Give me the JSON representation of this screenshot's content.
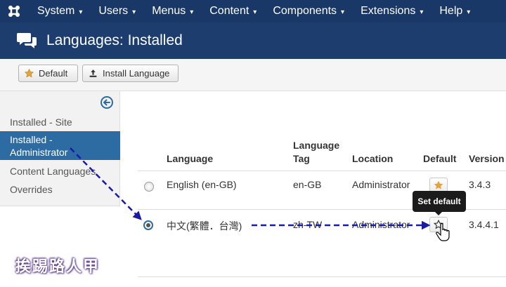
{
  "nav": {
    "items": [
      {
        "label": "System",
        "caret": "▾"
      },
      {
        "label": "Users",
        "caret": "▾"
      },
      {
        "label": "Menus",
        "caret": "▾"
      },
      {
        "label": "Content",
        "caret": "▾"
      },
      {
        "label": "Components",
        "caret": "▾"
      },
      {
        "label": "Extensions",
        "caret": "▾"
      },
      {
        "label": "Help",
        "caret": "▾"
      }
    ]
  },
  "header": {
    "title": "Languages: Installed"
  },
  "toolbar": {
    "default_label": "Default",
    "install_label": "Install Language"
  },
  "sidebar": {
    "items": [
      {
        "label": "Installed - Site"
      },
      {
        "label": "Installed - Administrator"
      },
      {
        "label": "Content Languages"
      },
      {
        "label": "Overrides"
      }
    ]
  },
  "table": {
    "headers": {
      "language": "Language",
      "tag": "Language Tag",
      "location": "Location",
      "default": "Default",
      "version": "Version"
    },
    "rows": [
      {
        "language": "English (en-GB)",
        "tag": "en-GB",
        "location": "Administrator",
        "version": "3.4.3",
        "is_default": true,
        "selected": false
      },
      {
        "language": "中文(繁體．台灣)",
        "tag": "zh-TW",
        "location": "Administrator",
        "version": "3.4.4.1",
        "is_default": false,
        "selected": true
      }
    ]
  },
  "tooltip": {
    "text": "Set default"
  },
  "watermark": {
    "text": "挨踢路人甲"
  },
  "colors": {
    "navbar": "#1a3867",
    "titlebar": "#1c3d6e",
    "active": "#2d6ca2",
    "star": "#e6a23c",
    "arrow": "#1a1aa8"
  }
}
